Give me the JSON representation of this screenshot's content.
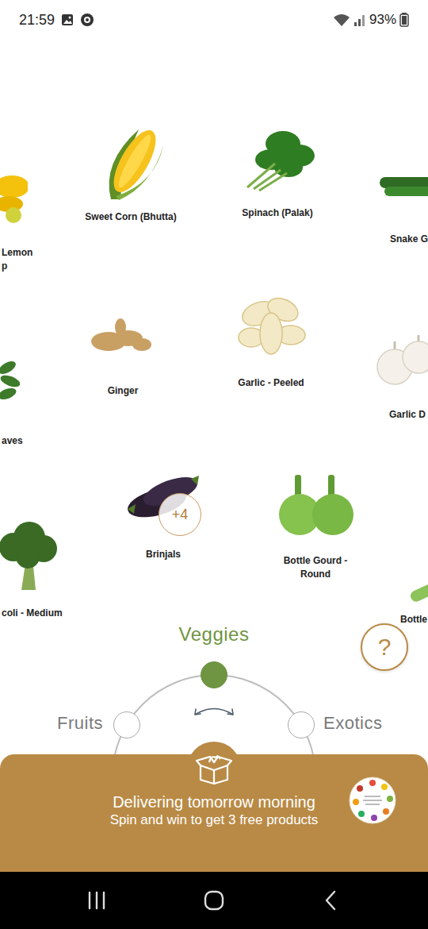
{
  "status_bar": {
    "time": "21:59",
    "battery": "93%"
  },
  "products": [
    {
      "name": "Lemon\np"
    },
    {
      "name": "Sweet Corn (Bhutta)"
    },
    {
      "name": "Spinach (Palak)"
    },
    {
      "name": "Snake G"
    },
    {
      "name": "aves"
    },
    {
      "name": "Ginger"
    },
    {
      "name": "Garlic - Peeled"
    },
    {
      "name": "Garlic D"
    },
    {
      "name": "coli - Medium"
    },
    {
      "name": "Brinjals",
      "more": "+4"
    },
    {
      "name": "Bottle Gourd -\nRound"
    },
    {
      "name": "Bottle"
    }
  ],
  "categories": [
    {
      "label": "Fruits",
      "selected": false
    },
    {
      "label": "Veggies",
      "selected": true
    },
    {
      "label": "Exotics",
      "selected": false
    }
  ],
  "help": "?",
  "banner": {
    "title": "Delivering tomorrow morning",
    "subtitle": "Spin and win to get 3 free products"
  }
}
